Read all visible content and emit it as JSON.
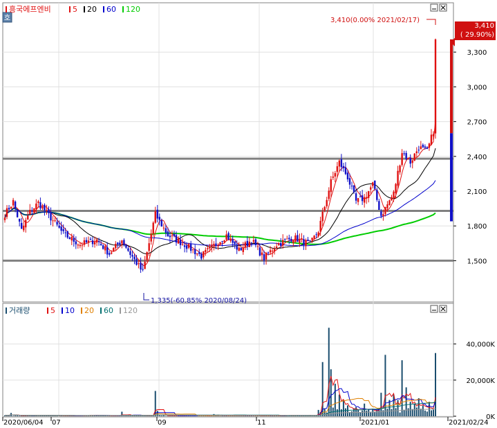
{
  "app": {
    "stock_name": "흥국에프엔비",
    "price_box_label": "호"
  },
  "price_legend": [
    {
      "label": "5",
      "color": "#e01010"
    },
    {
      "label": "20",
      "color": "#000000"
    },
    {
      "label": "60",
      "color": "#0000cc"
    },
    {
      "label": "120",
      "color": "#00cc00"
    }
  ],
  "volume_legend": {
    "title": "거래량",
    "items": [
      {
        "label": "5",
        "color": "#e01010"
      },
      {
        "label": "10",
        "color": "#0000cc"
      },
      {
        "label": "20",
        "color": "#e08000"
      },
      {
        "label": "60",
        "color": "#007070"
      },
      {
        "label": "120",
        "color": "#999999"
      }
    ]
  },
  "annotations": {
    "high": "3,410(0.00% 2021/02/17)",
    "low": "1,335(-60.85% 2020/08/24)"
  },
  "badge": {
    "price": "3,410",
    "change": "( 29.90%)"
  },
  "colors": {
    "up": "#e01010",
    "down": "#1010c8",
    "bg": "#ffffff",
    "grid": "#e0e0e0"
  },
  "chart_data": [
    {
      "type": "candlestick",
      "y_ticks": [
        "1,500",
        "1,800",
        "2,100",
        "2,400",
        "2,700",
        "3,000",
        "3,300"
      ],
      "y_tick_values": [
        1500,
        1800,
        2100,
        2400,
        2700,
        3000,
        3300
      ],
      "ylim": [
        1150,
        3600
      ],
      "horizontal_lines": [
        2380,
        1930,
        1500
      ],
      "x_labels": [
        "2020/06/04",
        "07",
        "09",
        "11",
        "2021/01",
        "2021/02/24"
      ],
      "ma_periods": [
        5,
        20,
        60,
        120
      ],
      "anchor_closes": [
        [
          0,
          1900
        ],
        [
          4,
          2010
        ],
        [
          8,
          1760
        ],
        [
          12,
          1920
        ],
        [
          16,
          2000
        ],
        [
          22,
          1870
        ],
        [
          28,
          1730
        ],
        [
          36,
          1640
        ],
        [
          44,
          1680
        ],
        [
          50,
          1560
        ],
        [
          56,
          1680
        ],
        [
          60,
          1560
        ],
        [
          66,
          1400
        ],
        [
          72,
          1900
        ],
        [
          78,
          1720
        ],
        [
          86,
          1640
        ],
        [
          94,
          1540
        ],
        [
          100,
          1630
        ],
        [
          106,
          1720
        ],
        [
          112,
          1590
        ],
        [
          118,
          1680
        ],
        [
          124,
          1520
        ],
        [
          130,
          1640
        ],
        [
          138,
          1700
        ],
        [
          146,
          1640
        ],
        [
          150,
          1760
        ],
        [
          156,
          2180
        ],
        [
          160,
          2350
        ],
        [
          164,
          2220
        ],
        [
          168,
          2010
        ],
        [
          172,
          2040
        ],
        [
          176,
          2160
        ],
        [
          180,
          1890
        ],
        [
          186,
          2080
        ],
        [
          190,
          2440
        ],
        [
          194,
          2350
        ],
        [
          198,
          2480
        ],
        [
          202,
          2440
        ],
        [
          205,
          2620
        ],
        [
          206,
          3410
        ]
      ]
    },
    {
      "type": "bar",
      "title": "거래량",
      "y_ticks": [
        "0K",
        "20,000K",
        "40,000K"
      ],
      "y_tick_values": [
        0,
        20000,
        40000
      ],
      "ylim": [
        0,
        56000
      ],
      "spikes": [
        [
          3,
          1800
        ],
        [
          56,
          2500
        ],
        [
          72,
          14000
        ],
        [
          73,
          3000
        ],
        [
          100,
          1200
        ],
        [
          150,
          3500
        ],
        [
          152,
          30000
        ],
        [
          155,
          49000
        ],
        [
          156,
          26000
        ],
        [
          158,
          18000
        ],
        [
          160,
          12000
        ],
        [
          162,
          9000
        ],
        [
          164,
          6000
        ],
        [
          168,
          5000
        ],
        [
          172,
          7000
        ],
        [
          176,
          4000
        ],
        [
          179,
          4000
        ],
        [
          180,
          13000
        ],
        [
          182,
          34000
        ],
        [
          184,
          9000
        ],
        [
          186,
          12000
        ],
        [
          188,
          9000
        ],
        [
          190,
          31000
        ],
        [
          192,
          16000
        ],
        [
          194,
          8000
        ],
        [
          196,
          7000
        ],
        [
          198,
          10000
        ],
        [
          200,
          6000
        ],
        [
          203,
          8000
        ],
        [
          206,
          35000
        ]
      ]
    }
  ]
}
